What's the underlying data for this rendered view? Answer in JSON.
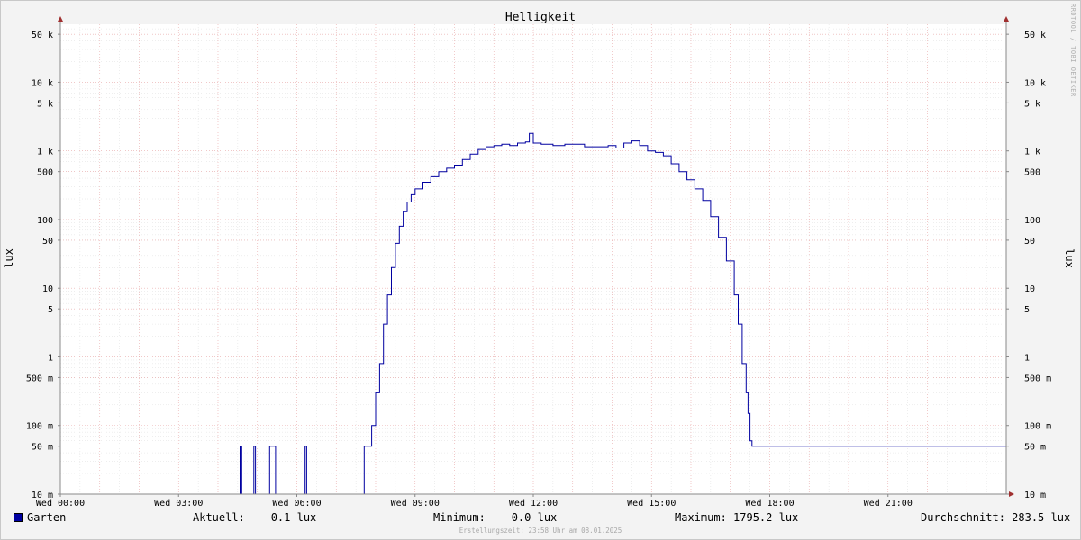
{
  "chart_data": {
    "type": "line",
    "title": "Helligkeit",
    "ylabel": "lux",
    "y_scale": "log",
    "ylim": [
      0.01,
      70000
    ],
    "xlim_hours": [
      0,
      24
    ],
    "y_ticks": [
      {
        "value": 0.01,
        "label": "10 m"
      },
      {
        "value": 0.05,
        "label": "50 m"
      },
      {
        "value": 0.1,
        "label": "100 m"
      },
      {
        "value": 0.5,
        "label": "500 m"
      },
      {
        "value": 1,
        "label": "1"
      },
      {
        "value": 5,
        "label": "5"
      },
      {
        "value": 10,
        "label": "10"
      },
      {
        "value": 50,
        "label": "50"
      },
      {
        "value": 100,
        "label": "100"
      },
      {
        "value": 500,
        "label": "500"
      },
      {
        "value": 1000,
        "label": "1 k"
      },
      {
        "value": 5000,
        "label": "5 k"
      },
      {
        "value": 10000,
        "label": "10 k"
      },
      {
        "value": 50000,
        "label": "50 k"
      }
    ],
    "x_ticks": [
      {
        "hour": 0,
        "label": "Wed 00:00"
      },
      {
        "hour": 3,
        "label": "Wed 03:00"
      },
      {
        "hour": 6,
        "label": "Wed 06:00"
      },
      {
        "hour": 9,
        "label": "Wed 09:00"
      },
      {
        "hour": 12,
        "label": "Wed 12:00"
      },
      {
        "hour": 15,
        "label": "Wed 15:00"
      },
      {
        "hour": 18,
        "label": "Wed 18:00"
      },
      {
        "hour": 21,
        "label": "Wed 21:00"
      }
    ],
    "grid": true,
    "series": [
      {
        "name": "Garten",
        "color": "#0000a0",
        "points": [
          [
            0,
            0.01
          ],
          [
            4.55,
            0.01
          ],
          [
            4.56,
            0.05
          ],
          [
            4.6,
            0.01
          ],
          [
            4.9,
            0.01
          ],
          [
            4.91,
            0.05
          ],
          [
            4.95,
            0.01
          ],
          [
            5.3,
            0.01
          ],
          [
            5.31,
            0.05
          ],
          [
            5.45,
            0.05
          ],
          [
            5.46,
            0.01
          ],
          [
            6.2,
            0.01
          ],
          [
            6.21,
            0.05
          ],
          [
            6.25,
            0.01
          ],
          [
            7.7,
            0.01
          ],
          [
            7.71,
            0.05
          ],
          [
            7.85,
            0.05
          ],
          [
            7.9,
            0.1
          ],
          [
            8.0,
            0.3
          ],
          [
            8.1,
            0.8
          ],
          [
            8.2,
            3
          ],
          [
            8.3,
            8
          ],
          [
            8.4,
            20
          ],
          [
            8.5,
            45
          ],
          [
            8.6,
            80
          ],
          [
            8.7,
            130
          ],
          [
            8.8,
            180
          ],
          [
            8.9,
            230
          ],
          [
            9.0,
            280
          ],
          [
            9.2,
            350
          ],
          [
            9.4,
            420
          ],
          [
            9.6,
            500
          ],
          [
            9.8,
            560
          ],
          [
            10.0,
            620
          ],
          [
            10.2,
            750
          ],
          [
            10.4,
            900
          ],
          [
            10.6,
            1050
          ],
          [
            10.8,
            1150
          ],
          [
            11.0,
            1200
          ],
          [
            11.2,
            1250
          ],
          [
            11.4,
            1200
          ],
          [
            11.6,
            1300
          ],
          [
            11.8,
            1350
          ],
          [
            11.9,
            1795.2
          ],
          [
            12.0,
            1300
          ],
          [
            12.2,
            1250
          ],
          [
            12.5,
            1200
          ],
          [
            12.8,
            1250
          ],
          [
            13.0,
            1250
          ],
          [
            13.3,
            1150
          ],
          [
            13.6,
            1150
          ],
          [
            13.9,
            1200
          ],
          [
            14.1,
            1100
          ],
          [
            14.3,
            1300
          ],
          [
            14.5,
            1400
          ],
          [
            14.7,
            1200
          ],
          [
            14.9,
            1000
          ],
          [
            15.1,
            950
          ],
          [
            15.3,
            850
          ],
          [
            15.5,
            650
          ],
          [
            15.7,
            500
          ],
          [
            15.9,
            380
          ],
          [
            16.1,
            280
          ],
          [
            16.3,
            190
          ],
          [
            16.5,
            110
          ],
          [
            16.7,
            55
          ],
          [
            16.9,
            25
          ],
          [
            17.1,
            8
          ],
          [
            17.2,
            3
          ],
          [
            17.3,
            0.8
          ],
          [
            17.4,
            0.3
          ],
          [
            17.45,
            0.15
          ],
          [
            17.5,
            0.06
          ],
          [
            17.55,
            0.05
          ],
          [
            24,
            0.05
          ]
        ]
      }
    ]
  },
  "legend": {
    "series_name": "Garten",
    "aktuell": "Aktuell:    0.1 lux",
    "minimum": "Minimum:    0.0 lux",
    "maximum": "Maximum: 1795.2 lux",
    "durchschnitt": "Durchschnitt: 283.5 lux"
  },
  "footer": "Erstellungszeit: 23:58 Uhr am 08.01.2025",
  "watermark": "RRDTOOL / TOBI OETIKER"
}
